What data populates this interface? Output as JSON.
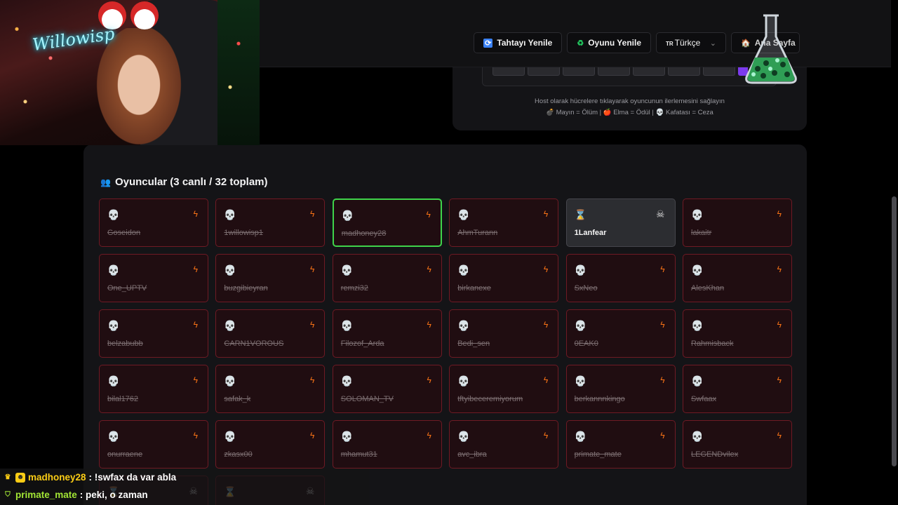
{
  "nav": {
    "refresh_board": "Tahtayı Yenile",
    "refresh_game": "Oyunu Yenile",
    "language_code": "TR",
    "language_value": "Türkçe",
    "home": "Ana Sayfa"
  },
  "board": {
    "host_hint": "Host olarak hücrelere tıklayarak oyuncunun ilerlemesini sağlayın",
    "legend": "💣 Mayın = Ölüm | 🍎 Elma = Ödül | 💀 Kafatası = Ceza"
  },
  "players": {
    "title": "Oyuncular (3 canlı / 32 toplam)",
    "list": [
      {
        "name": "Goseidon",
        "status": "dead"
      },
      {
        "name": "1willowisp1",
        "status": "dead"
      },
      {
        "name": "madhoney28",
        "status": "dead",
        "highlighted": true
      },
      {
        "name": "AhmTurann",
        "status": "dead"
      },
      {
        "name": "1Lanfear",
        "status": "alive"
      },
      {
        "name": "lakaitr",
        "status": "dead"
      },
      {
        "name": "One_UPTV",
        "status": "dead"
      },
      {
        "name": "buzgibieyran",
        "status": "dead"
      },
      {
        "name": "remzi32",
        "status": "dead"
      },
      {
        "name": "birkanexe",
        "status": "dead"
      },
      {
        "name": "SxNeo",
        "status": "dead"
      },
      {
        "name": "AlesKhan",
        "status": "dead"
      },
      {
        "name": "belzabubb",
        "status": "dead"
      },
      {
        "name": "CARN1VOROUS",
        "status": "dead"
      },
      {
        "name": "Filozof_Arda",
        "status": "dead"
      },
      {
        "name": "Bedi_sen",
        "status": "dead"
      },
      {
        "name": "0EAK0",
        "status": "dead"
      },
      {
        "name": "Rahmisback",
        "status": "dead"
      },
      {
        "name": "bilal1762",
        "status": "dead"
      },
      {
        "name": "safak_k",
        "status": "dead"
      },
      {
        "name": "SOLOMAN_TV",
        "status": "dead"
      },
      {
        "name": "tftyibeceremiyorum",
        "status": "dead"
      },
      {
        "name": "berkannnkingo",
        "status": "dead"
      },
      {
        "name": "Swfaax",
        "status": "dead"
      },
      {
        "name": "onurraene",
        "status": "dead"
      },
      {
        "name": "zkasx00",
        "status": "dead"
      },
      {
        "name": "mhamut31",
        "status": "dead"
      },
      {
        "name": "avc_ibra",
        "status": "dead"
      },
      {
        "name": "primate_mate",
        "status": "dead"
      },
      {
        "name": "LEGENDvilex",
        "status": "dead"
      },
      {
        "name": "",
        "status": "alive"
      },
      {
        "name": "",
        "status": "alive"
      }
    ]
  },
  "chat": [
    {
      "user": "madhoney28",
      "message": ": !swfax da var abla"
    },
    {
      "user": "primate_mate",
      "message": ": peki, o zaman"
    }
  ],
  "stream": {
    "neon_sign": "Willowisp"
  }
}
